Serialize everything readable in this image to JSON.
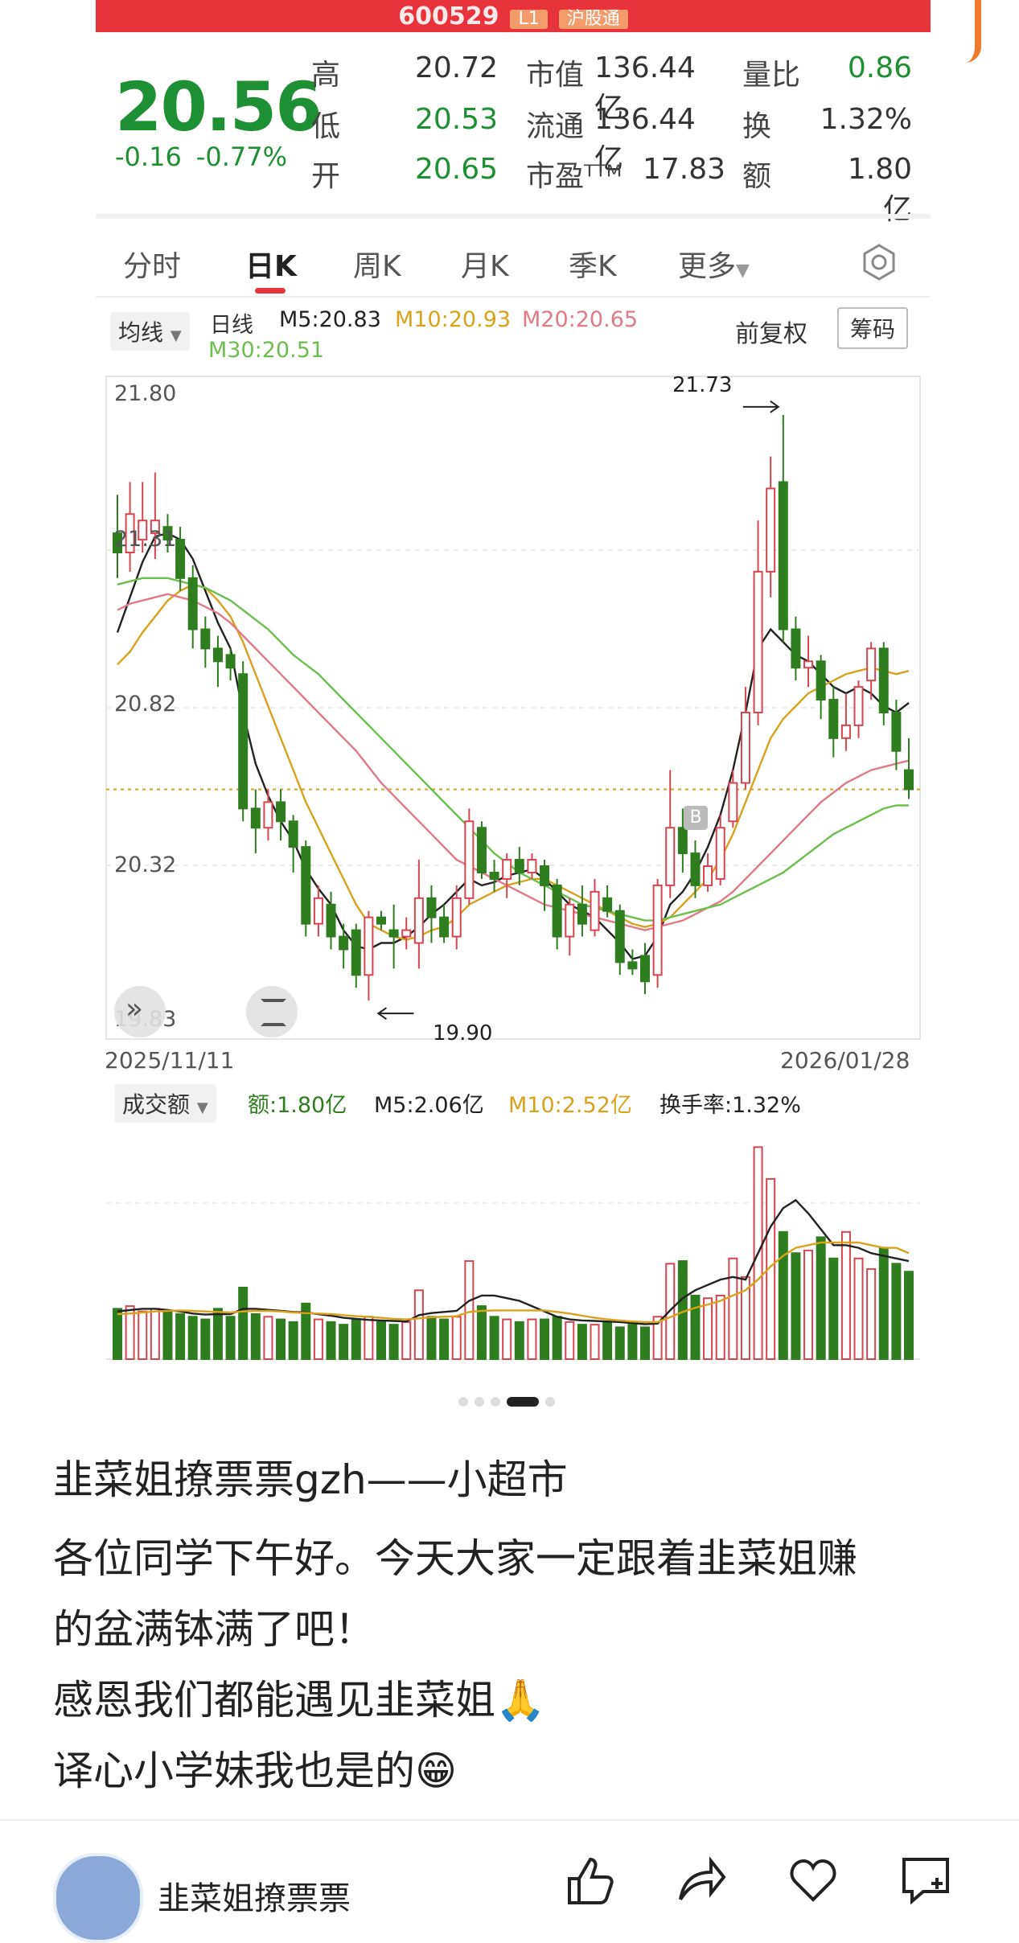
{
  "top_header": {
    "code": "600529",
    "tags": [
      "L1",
      "沪股通"
    ]
  },
  "quote": {
    "price": "20.56",
    "change": "-0.16",
    "change_pct": "-0.77%",
    "rows": [
      {
        "l1": "高",
        "v1": "20.72",
        "l2": "市值",
        "v2": "136.44亿",
        "l3": "量比",
        "v3": "0.86"
      },
      {
        "l1": "低",
        "v1": "20.53",
        "l2": "流通",
        "v2": "136.44亿",
        "l3": "换",
        "v3": "1.32%"
      },
      {
        "l1": "开",
        "v1": "20.65",
        "l2": "市盈ᵀᵀᴹ",
        "v2": "17.83",
        "l3": "额",
        "v3": "1.80亿"
      }
    ]
  },
  "tabs": [
    "分时",
    "日K",
    "周K",
    "月K",
    "季K",
    "更多"
  ],
  "active_tab": "日K",
  "ma_bar": {
    "type_label": "均线",
    "line_label": "日线",
    "m5": "M5:20.83",
    "m10": "M10:20.93",
    "m20": "M20:20.65",
    "m30": "M30:20.51",
    "adjust_label": "前复权",
    "chips_button": "筹码",
    "colors": {
      "m5": "#222222",
      "m10": "#d9a21b",
      "m20": "#e07a86",
      "m30": "#6cbf4f"
    }
  },
  "chart_data": [
    {
      "type": "candlestick",
      "title": "日K",
      "y_ticks": [
        "21.80",
        "21.31",
        "20.82",
        "20.32",
        "19.83"
      ],
      "ylim": [
        19.83,
        21.8
      ],
      "start_date": "2025/11/11",
      "end_date": "2026/01/28",
      "high_label": "21.73",
      "low_label": "19.90",
      "markers": [
        "B"
      ],
      "grid": true,
      "candles": [
        {
          "o": 21.36,
          "c": 21.3,
          "h": 21.48,
          "l": 21.22
        },
        {
          "o": 21.3,
          "c": 21.42,
          "h": 21.52,
          "l": 21.24
        },
        {
          "o": 21.34,
          "c": 21.4,
          "h": 21.52,
          "l": 21.3
        },
        {
          "o": 21.36,
          "c": 21.4,
          "h": 21.55,
          "l": 21.28
        },
        {
          "o": 21.38,
          "c": 21.34,
          "h": 21.42,
          "l": 21.3
        },
        {
          "o": 21.34,
          "c": 21.22,
          "h": 21.38,
          "l": 21.18
        },
        {
          "o": 21.22,
          "c": 21.06,
          "h": 21.26,
          "l": 21.0
        },
        {
          "o": 21.06,
          "c": 21.0,
          "h": 21.1,
          "l": 20.94
        },
        {
          "o": 21.0,
          "c": 20.96,
          "h": 21.04,
          "l": 20.88
        },
        {
          "o": 20.98,
          "c": 20.94,
          "h": 21.0,
          "l": 20.9
        },
        {
          "o": 20.92,
          "c": 20.5,
          "h": 20.96,
          "l": 20.46
        },
        {
          "o": 20.5,
          "c": 20.44,
          "h": 20.56,
          "l": 20.36
        },
        {
          "o": 20.44,
          "c": 20.52,
          "h": 20.56,
          "l": 20.4
        },
        {
          "o": 20.52,
          "c": 20.46,
          "h": 20.56,
          "l": 20.4
        },
        {
          "o": 20.46,
          "c": 20.38,
          "h": 20.48,
          "l": 20.3
        },
        {
          "o": 20.38,
          "c": 20.14,
          "h": 20.4,
          "l": 20.1
        },
        {
          "o": 20.14,
          "c": 20.22,
          "h": 20.26,
          "l": 20.1
        },
        {
          "o": 20.2,
          "c": 20.1,
          "h": 20.24,
          "l": 20.06
        },
        {
          "o": 20.1,
          "c": 20.06,
          "h": 20.14,
          "l": 20.0
        },
        {
          "o": 20.12,
          "c": 19.98,
          "h": 20.14,
          "l": 19.94
        },
        {
          "o": 19.98,
          "c": 20.16,
          "h": 20.18,
          "l": 19.9
        },
        {
          "o": 20.16,
          "c": 20.14,
          "h": 20.18,
          "l": 20.12
        },
        {
          "o": 20.12,
          "c": 20.1,
          "h": 20.2,
          "l": 20.0
        },
        {
          "o": 20.1,
          "c": 20.12,
          "h": 20.16,
          "l": 20.06
        },
        {
          "o": 20.08,
          "c": 20.22,
          "h": 20.34,
          "l": 20.0
        },
        {
          "o": 20.22,
          "c": 20.16,
          "h": 20.26,
          "l": 20.08
        },
        {
          "o": 20.16,
          "c": 20.1,
          "h": 20.2,
          "l": 20.08
        },
        {
          "o": 20.1,
          "c": 20.22,
          "h": 20.26,
          "l": 20.06
        },
        {
          "o": 20.22,
          "c": 20.46,
          "h": 20.5,
          "l": 20.2
        },
        {
          "o": 20.44,
          "c": 20.3,
          "h": 20.46,
          "l": 20.28
        },
        {
          "o": 20.3,
          "c": 20.28,
          "h": 20.34,
          "l": 20.24
        },
        {
          "o": 20.28,
          "c": 20.34,
          "h": 20.36,
          "l": 20.22
        },
        {
          "o": 20.34,
          "c": 20.3,
          "h": 20.38,
          "l": 20.26
        },
        {
          "o": 20.3,
          "c": 20.34,
          "h": 20.36,
          "l": 20.28
        },
        {
          "o": 20.32,
          "c": 20.26,
          "h": 20.34,
          "l": 20.18
        },
        {
          "o": 20.26,
          "c": 20.1,
          "h": 20.28,
          "l": 20.06
        },
        {
          "o": 20.1,
          "c": 20.2,
          "h": 20.22,
          "l": 20.04
        },
        {
          "o": 20.2,
          "c": 20.14,
          "h": 20.26,
          "l": 20.1
        },
        {
          "o": 20.12,
          "c": 20.24,
          "h": 20.28,
          "l": 20.1
        },
        {
          "o": 20.22,
          "c": 20.18,
          "h": 20.26,
          "l": 20.16
        },
        {
          "o": 20.18,
          "c": 20.02,
          "h": 20.2,
          "l": 19.98
        },
        {
          "o": 20.02,
          "c": 20.0,
          "h": 20.06,
          "l": 19.98
        },
        {
          "o": 20.04,
          "c": 19.96,
          "h": 20.08,
          "l": 19.92
        },
        {
          "o": 19.98,
          "c": 20.26,
          "h": 20.28,
          "l": 19.94
        },
        {
          "o": 20.26,
          "c": 20.44,
          "h": 20.62,
          "l": 20.22
        },
        {
          "o": 20.44,
          "c": 20.36,
          "h": 20.5,
          "l": 20.3
        },
        {
          "o": 20.36,
          "c": 20.26,
          "h": 20.4,
          "l": 20.22
        },
        {
          "o": 20.26,
          "c": 20.32,
          "h": 20.36,
          "l": 20.24
        },
        {
          "o": 20.28,
          "c": 20.44,
          "h": 20.48,
          "l": 20.26
        },
        {
          "o": 20.46,
          "c": 20.58,
          "h": 20.62,
          "l": 20.44
        },
        {
          "o": 20.58,
          "c": 20.8,
          "h": 20.88,
          "l": 20.56
        },
        {
          "o": 20.8,
          "c": 21.24,
          "h": 21.4,
          "l": 20.76
        },
        {
          "o": 21.24,
          "c": 21.5,
          "h": 21.6,
          "l": 21.16
        },
        {
          "o": 21.52,
          "c": 21.06,
          "h": 21.73,
          "l": 21.02
        },
        {
          "o": 21.06,
          "c": 20.94,
          "h": 21.1,
          "l": 20.9
        },
        {
          "o": 20.94,
          "c": 20.96,
          "h": 21.04,
          "l": 20.88
        },
        {
          "o": 20.96,
          "c": 20.84,
          "h": 20.98,
          "l": 20.78
        },
        {
          "o": 20.84,
          "c": 20.72,
          "h": 20.88,
          "l": 20.66
        },
        {
          "o": 20.72,
          "c": 20.76,
          "h": 20.86,
          "l": 20.68
        },
        {
          "o": 20.76,
          "c": 20.88,
          "h": 20.9,
          "l": 20.72
        },
        {
          "o": 20.9,
          "c": 21.0,
          "h": 21.02,
          "l": 20.84
        },
        {
          "o": 21.0,
          "c": 20.8,
          "h": 21.02,
          "l": 20.76
        },
        {
          "o": 20.8,
          "c": 20.68,
          "h": 20.84,
          "l": 20.62
        },
        {
          "o": 20.62,
          "c": 20.56,
          "h": 20.72,
          "l": 20.53
        }
      ],
      "ma_series": [
        {
          "name": "M5",
          "color": "#222222",
          "values": [
            21.05,
            21.16,
            21.27,
            21.35,
            21.36,
            21.34,
            21.28,
            21.18,
            21.08,
            21.0,
            20.8,
            20.64,
            20.54,
            20.46,
            20.4,
            20.31,
            20.25,
            20.2,
            20.12,
            20.07,
            20.06,
            20.08,
            20.08,
            20.1,
            20.13,
            20.17,
            20.2,
            20.24,
            20.28,
            20.26,
            20.27,
            20.29,
            20.3,
            20.31,
            20.28,
            20.24,
            20.2,
            20.18,
            20.16,
            20.12,
            20.08,
            20.03,
            20.04,
            20.1,
            20.2,
            20.24,
            20.3,
            20.38,
            20.48,
            20.62,
            20.8,
            21.0,
            21.06,
            21.02,
            20.98,
            20.96,
            20.92,
            20.88,
            20.86,
            20.88,
            20.86,
            20.82,
            20.8,
            20.83
          ]
        },
        {
          "name": "M10",
          "color": "#d9a21b",
          "values": [
            20.95,
            20.99,
            21.05,
            21.1,
            21.15,
            21.18,
            21.2,
            21.19,
            21.15,
            21.1,
            21.02,
            20.92,
            20.82,
            20.72,
            20.62,
            20.52,
            20.44,
            20.36,
            20.28,
            20.2,
            20.14,
            20.12,
            20.1,
            20.09,
            20.1,
            20.12,
            20.13,
            20.16,
            20.2,
            20.22,
            20.24,
            20.26,
            20.27,
            20.28,
            20.28,
            20.26,
            20.24,
            20.22,
            20.2,
            20.18,
            20.16,
            20.14,
            20.13,
            20.14,
            20.16,
            20.2,
            20.24,
            20.28,
            20.34,
            20.42,
            20.52,
            20.62,
            20.72,
            20.78,
            20.82,
            20.86,
            20.88,
            20.9,
            20.92,
            20.93,
            20.94,
            20.93,
            20.92,
            20.93
          ]
        },
        {
          "name": "M20",
          "color": "#e07a86",
          "values": [
            21.12,
            21.14,
            21.15,
            21.16,
            21.17,
            21.16,
            21.15,
            21.13,
            21.11,
            21.08,
            21.04,
            21.0,
            20.96,
            20.92,
            20.88,
            20.84,
            20.8,
            20.76,
            20.72,
            20.68,
            20.63,
            20.58,
            20.54,
            20.5,
            20.46,
            20.42,
            20.38,
            20.34,
            20.32,
            20.3,
            20.28,
            20.26,
            20.24,
            20.22,
            20.2,
            20.19,
            20.18,
            20.17,
            20.16,
            20.15,
            20.14,
            20.13,
            20.12,
            20.13,
            20.14,
            20.15,
            20.17,
            20.19,
            20.21,
            20.24,
            20.28,
            20.32,
            20.36,
            20.4,
            20.44,
            20.48,
            20.52,
            20.55,
            20.58,
            20.6,
            20.62,
            20.63,
            20.64,
            20.65
          ]
        },
        {
          "name": "M30",
          "color": "#6cbf4f",
          "values": [
            21.2,
            21.21,
            21.22,
            21.22,
            21.22,
            21.21,
            21.2,
            21.19,
            21.17,
            21.15,
            21.12,
            21.09,
            21.06,
            21.02,
            20.98,
            20.95,
            20.92,
            20.88,
            20.84,
            20.8,
            20.76,
            20.72,
            20.68,
            20.64,
            20.6,
            20.56,
            20.52,
            20.48,
            20.44,
            20.4,
            20.36,
            20.33,
            20.3,
            20.28,
            20.26,
            20.24,
            20.22,
            20.2,
            20.19,
            20.18,
            20.17,
            20.16,
            20.15,
            20.15,
            20.16,
            20.17,
            20.18,
            20.19,
            20.2,
            20.22,
            20.24,
            20.26,
            20.28,
            20.3,
            20.33,
            20.36,
            20.39,
            20.42,
            20.44,
            20.46,
            20.48,
            20.5,
            20.51,
            20.51
          ]
        }
      ]
    },
    {
      "type": "bar",
      "title": "成交额",
      "legend": [
        "额:1.80亿",
        "M5:2.06亿",
        "M10:2.52亿",
        "换手率:1.32%"
      ],
      "values": [
        1.9,
        2.0,
        1.8,
        1.9,
        1.8,
        1.7,
        1.6,
        1.5,
        1.9,
        1.6,
        2.7,
        1.7,
        1.6,
        1.5,
        1.4,
        2.1,
        1.5,
        1.4,
        1.3,
        1.5,
        1.6,
        1.4,
        1.3,
        1.4,
        2.6,
        1.6,
        1.5,
        1.6,
        3.7,
        2.0,
        1.6,
        1.5,
        1.4,
        1.5,
        1.5,
        1.6,
        1.4,
        1.3,
        1.3,
        1.4,
        1.2,
        1.3,
        1.2,
        1.6,
        3.6,
        3.7,
        2.4,
        2.3,
        2.4,
        3.8,
        3.1,
        8.0,
        6.8,
        4.8,
        4.0,
        4.1,
        4.6,
        3.8,
        4.8,
        3.8,
        3.4,
        4.2,
        3.6,
        3.3
      ],
      "m5": [
        1.8,
        1.85,
        1.9,
        1.9,
        1.85,
        1.8,
        1.72,
        1.68,
        1.7,
        1.7,
        1.9,
        1.9,
        1.86,
        1.82,
        1.78,
        1.76,
        1.7,
        1.64,
        1.56,
        1.52,
        1.48,
        1.46,
        1.44,
        1.42,
        1.66,
        1.74,
        1.78,
        1.82,
        2.2,
        2.4,
        2.4,
        2.3,
        2.2,
        2.0,
        1.8,
        1.6,
        1.5,
        1.46,
        1.44,
        1.42,
        1.4,
        1.36,
        1.32,
        1.34,
        1.84,
        2.3,
        2.6,
        2.8,
        3.0,
        3.1,
        3.0,
        4.0,
        5.0,
        5.7,
        6.0,
        5.5,
        4.9,
        4.3,
        4.3,
        4.2,
        4.0,
        3.9,
        3.8,
        3.7
      ],
      "m10": [
        1.7,
        1.72,
        1.76,
        1.8,
        1.82,
        1.84,
        1.82,
        1.8,
        1.78,
        1.76,
        1.8,
        1.82,
        1.82,
        1.8,
        1.76,
        1.74,
        1.72,
        1.7,
        1.66,
        1.62,
        1.6,
        1.56,
        1.52,
        1.5,
        1.54,
        1.58,
        1.6,
        1.62,
        1.78,
        1.82,
        1.84,
        1.84,
        1.84,
        1.84,
        1.84,
        1.78,
        1.72,
        1.64,
        1.56,
        1.5,
        1.46,
        1.42,
        1.4,
        1.4,
        1.58,
        1.78,
        1.94,
        2.06,
        2.2,
        2.4,
        2.6,
        3.0,
        3.5,
        3.9,
        4.2,
        4.3,
        4.4,
        4.4,
        4.4,
        4.4,
        4.3,
        4.2,
        4.2,
        4.0
      ],
      "ylim": [
        0,
        8.8
      ]
    }
  ],
  "page_dots": 5,
  "active_dot": 3,
  "post": {
    "title": "韭菜姐撩票票gzh——小超市",
    "lines": [
      "各位同学下午好。今天大家一定跟着韭菜姐赚",
      "的盆满钵满了吧！",
      "感恩我们都能遇见韭菜姐🙏",
      "译心小学妹我也是的😁"
    ]
  },
  "bottom": {
    "author": "韭菜姐撩票票"
  }
}
